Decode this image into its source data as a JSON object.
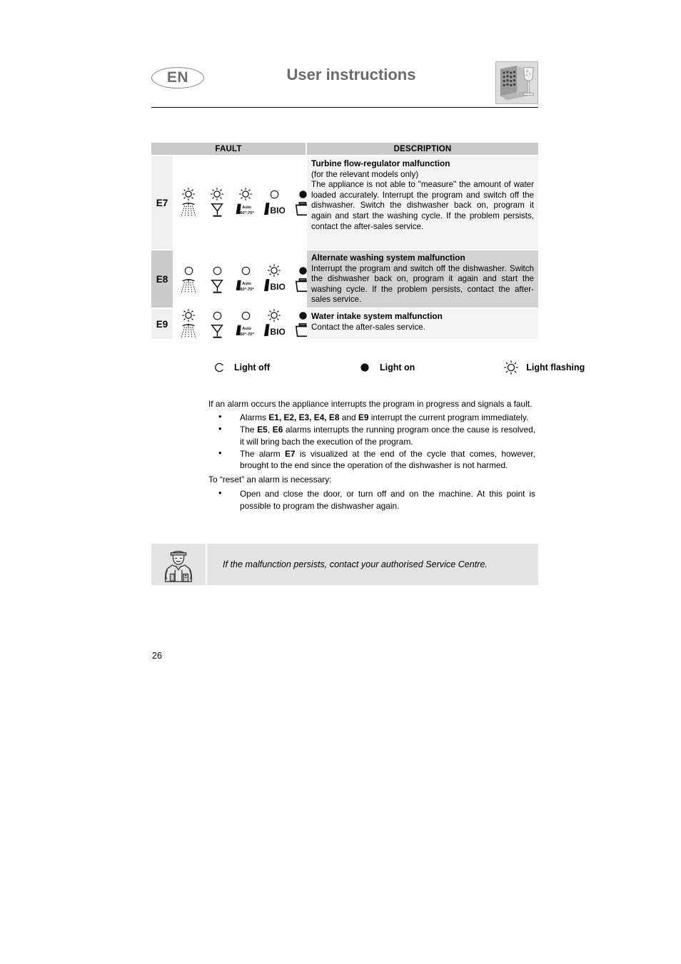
{
  "header": {
    "language_badge": "EN",
    "title": "User instructions",
    "logo_icon": "dishwasher-glass-icon"
  },
  "fault_table": {
    "columns": [
      "FAULT",
      "DESCRIPTION"
    ],
    "led_states_legend_key": {
      "off": "light-off-circle-icon",
      "on": "light-on-filled-circle-icon",
      "flashing": "light-flashing-sun-icon"
    },
    "symbols": [
      "spray-arm-icon",
      "glass-goblet-icon",
      "auto-60-70-icon",
      "bio-icon",
      "pot-basket-icon"
    ],
    "symbol_labels": {
      "auto_top": "Auto",
      "auto_bottom": "60°-70°",
      "bio": "BIO"
    },
    "rows": [
      {
        "code": "E7",
        "leds": [
          "flashing",
          "flashing",
          "flashing",
          "off",
          "on"
        ],
        "title": "Turbine flow-regulator malfunction",
        "subtitle": "(for the relevant models only)",
        "body": "The appliance is not able to \"measure\" the amount of water loaded accurately. Interrupt the program and switch off the dishwasher. Switch the dishwasher back on, program it again and start the washing cycle. If the problem persists, contact the after-sales service."
      },
      {
        "code": "E8",
        "leds": [
          "off",
          "off",
          "off",
          "flashing",
          "on"
        ],
        "title": "Alternate washing system malfunction",
        "subtitle": "",
        "body": "Interrupt the program and switch off the dishwasher. Switch the dishwasher back on, program it again and start the washing cycle. If the problem persists, contact the after-sales service."
      },
      {
        "code": "E9",
        "leds": [
          "flashing",
          "off",
          "off",
          "flashing",
          "on"
        ],
        "title": "Water intake system malfunction",
        "subtitle": "",
        "body": "Contact the after-sales service."
      }
    ]
  },
  "legend": [
    {
      "icon": "light-off-circle-icon",
      "label": "Light off"
    },
    {
      "icon": "light-on-filled-circle-icon",
      "label": "Light on"
    },
    {
      "icon": "light-flashing-sun-icon",
      "label": "Light flashing"
    }
  ],
  "body": {
    "intro": "If an alarm occurs the appliance interrupts the program in progress and signals a fault.",
    "bullets_1": [
      "Alarms <b>E1, E2, E3, E4, E8</b> and <b>E9</b> interrupt the current program immediately.",
      "The <b>E5</b>, <b>E6</b> alarms interrupts the running program once the cause is resolved, it will bring bach the execution of the program.",
      "The alarm <b>E7</b> is visualized at the end of the cycle that comes, however, brought to the end since the operation of the dishwasher is not harmed."
    ],
    "reset_line": "To “reset” an alarm is necessary:",
    "bullets_2": [
      "Open and close the door, or turn off and on the machine. At this point is possible to program the dishwasher again."
    ]
  },
  "note": {
    "icon": "service-technician-icon",
    "text": "If the malfunction persists, contact your authorised Service Centre."
  },
  "page_number": "26"
}
